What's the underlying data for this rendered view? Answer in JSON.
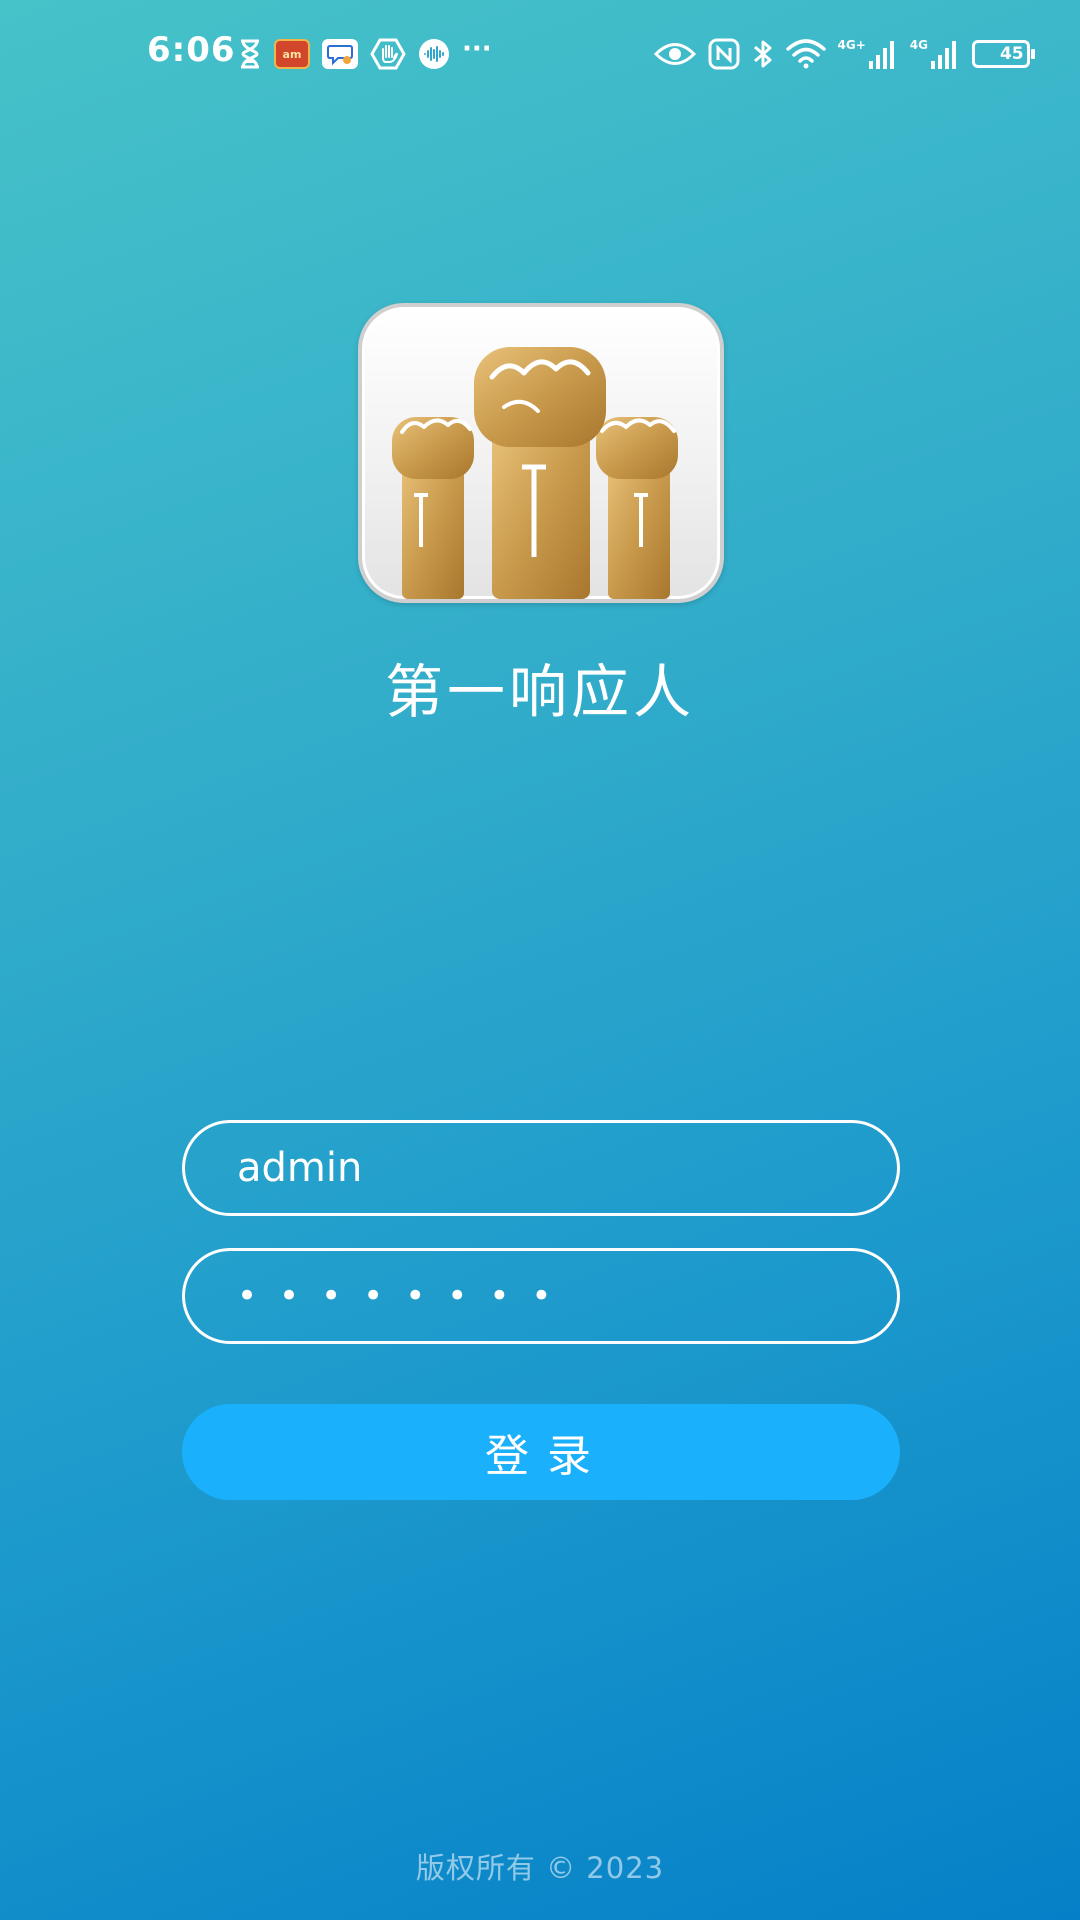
{
  "status_bar": {
    "time": "6:06",
    "left_icons": [
      "hourglass-icon",
      "app-badge-icon",
      "message-icon",
      "hand-icon",
      "voice-icon",
      "more-icon"
    ],
    "app_badge_text": "am",
    "more_text": "···",
    "network_1": "4G+",
    "network_2": "4G",
    "battery_level": "45",
    "battery_fraction": 0.45
  },
  "app": {
    "title": "第一响应人",
    "logo_icon": "raised-fists-icon"
  },
  "login_form": {
    "username_value": "admin",
    "password_value": "••••••••"
  },
  "login_button": {
    "label": "登录"
  },
  "footer": {
    "copyright": "版权所有 © 2023"
  },
  "colors": {
    "background_start": "#46c2c9",
    "background_end": "#0580c8",
    "button": "#1ab0fb",
    "fist_gold": "#c99a4c"
  }
}
